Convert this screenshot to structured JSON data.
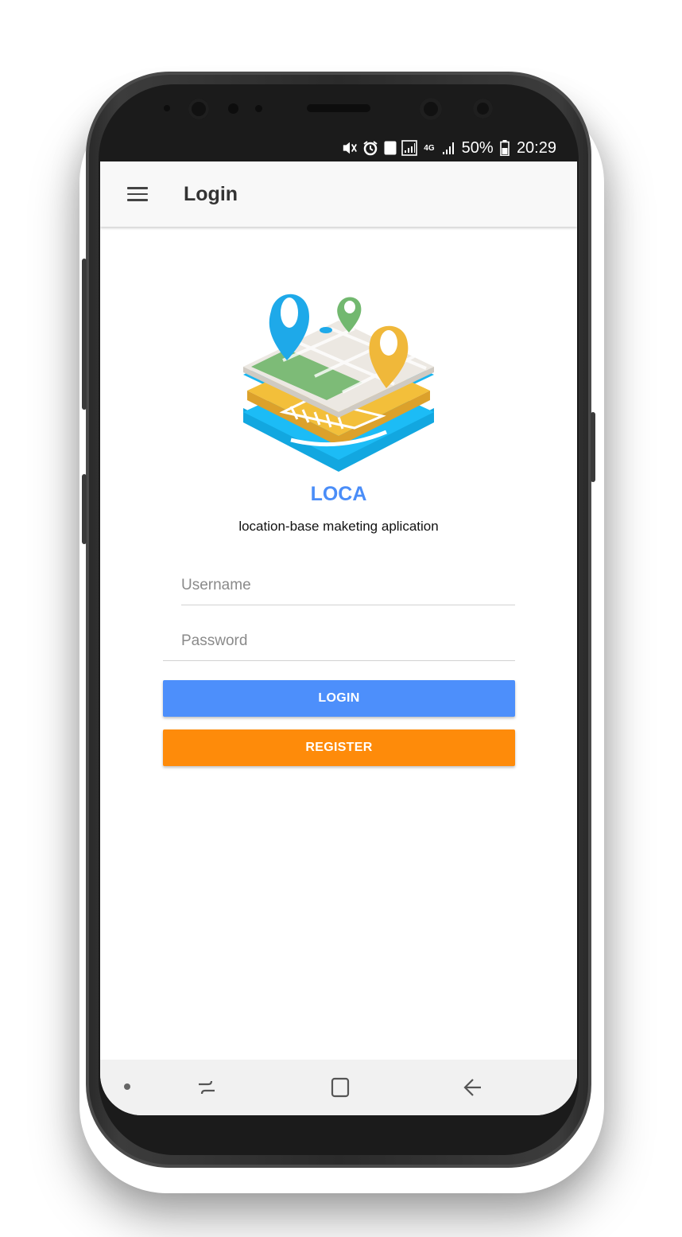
{
  "status_bar": {
    "icons": [
      "mute-vibrate-icon",
      "alarm-icon",
      "sim-1-icon",
      "signal-1-icon",
      "network-4g-icon",
      "signal-2-icon"
    ],
    "sim_slot": "1",
    "network": "4G",
    "battery": "50%",
    "time": "20:29"
  },
  "app_bar": {
    "menu_icon": "hamburger-menu-icon",
    "title": "Login"
  },
  "brand": {
    "logo_icon": "map-pins-logo",
    "name": "LOCA",
    "tagline": "location-base maketing aplication"
  },
  "form": {
    "username_placeholder": "Username",
    "password_placeholder": "Password",
    "login_label": "LOGIN",
    "register_label": "REGISTER"
  },
  "colors": {
    "brand": "#4a8df8",
    "login_button": "#4d8ffb",
    "register_button": "#fe8b0a"
  },
  "nav_bar": {
    "icons": [
      "nav-dot-icon",
      "recent-apps-icon",
      "home-icon",
      "back-icon"
    ]
  }
}
